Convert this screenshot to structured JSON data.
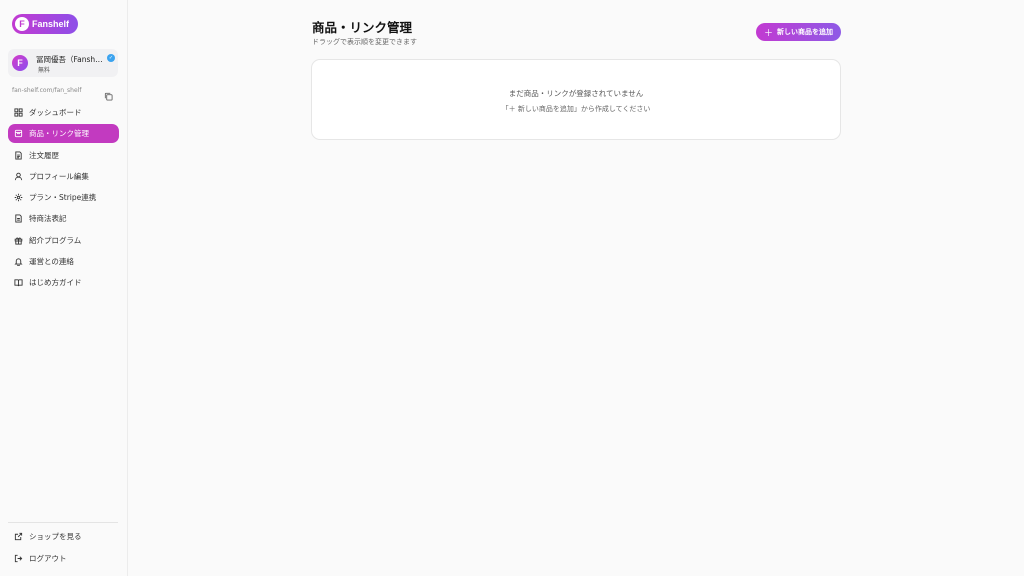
{
  "brand": {
    "logo_letter": "F",
    "name": "Fanshelf"
  },
  "profile": {
    "avatar_letter": "F",
    "name": "冨岡優吾（Fanshelf）",
    "plan": "無料",
    "verified_icon": "check-badge-icon"
  },
  "shop": {
    "url": "fan-shelf.com/fan_shelf",
    "copy_icon": "copy-icon"
  },
  "nav": [
    {
      "label": "ダッシュボード",
      "icon": "dashboard-icon",
      "active": false
    },
    {
      "label": "商品・リンク管理",
      "icon": "box-icon",
      "active": true
    },
    {
      "label": "注文履歴",
      "icon": "receipt-icon",
      "active": false
    },
    {
      "label": "プロフィール編集",
      "icon": "user-icon",
      "active": false
    },
    {
      "label": "プラン・Stripe連携",
      "icon": "gear-icon",
      "active": false
    },
    {
      "label": "特商法表記",
      "icon": "document-icon",
      "active": false
    },
    {
      "label": "紹介プログラム",
      "icon": "gift-icon",
      "active": false
    },
    {
      "label": "運営との連絡",
      "icon": "bell-icon",
      "active": false
    },
    {
      "label": "はじめ方ガイド",
      "icon": "book-icon",
      "active": false
    }
  ],
  "bottom_nav": [
    {
      "label": "ショップを見る",
      "icon": "external-link-icon"
    },
    {
      "label": "ログアウト",
      "icon": "logout-icon"
    }
  ],
  "main": {
    "title": "商品・リンク管理",
    "subtitle": "ドラッグで表示順を変更できます",
    "add_button": "新しい商品を追加",
    "empty_title": "まだ商品・リンクが登録されていません",
    "empty_hint": "「＋ 新しい商品を追加」から作成してください"
  },
  "colors": {
    "accent": "#c23ac0",
    "accent_gradient_end": "#8e5ae6",
    "verified": "#3ba3ef"
  }
}
